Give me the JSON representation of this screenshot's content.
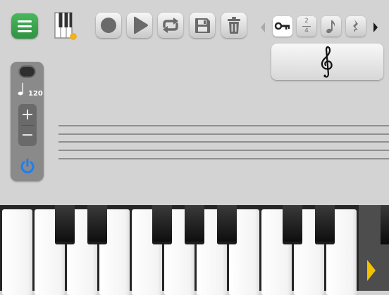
{
  "toolbar": {
    "menu_icon": "hamburger-icon",
    "piano_icon": "piano-keys-icon",
    "buttons": [
      "record-icon",
      "play-icon",
      "loop-icon",
      "save-icon",
      "trash-icon"
    ]
  },
  "tabs": {
    "items": [
      "key-icon",
      "time-signature",
      "note-icon",
      "rest-icon"
    ],
    "time_signature_top": "2",
    "time_signature_bottom": "4",
    "selected_index": 0
  },
  "clef": {
    "icon": "treble-clef-icon"
  },
  "tempo": {
    "value": "120",
    "plus_label": "+",
    "minus_label": "−",
    "power_icon": "power-icon"
  },
  "colors": {
    "background": "#d3d3d3",
    "menu_green": "#3aa24f",
    "power_blue": "#1f7ef0",
    "scroll_arrow": "#f2c200",
    "piano_dot": "#f2b01e"
  }
}
